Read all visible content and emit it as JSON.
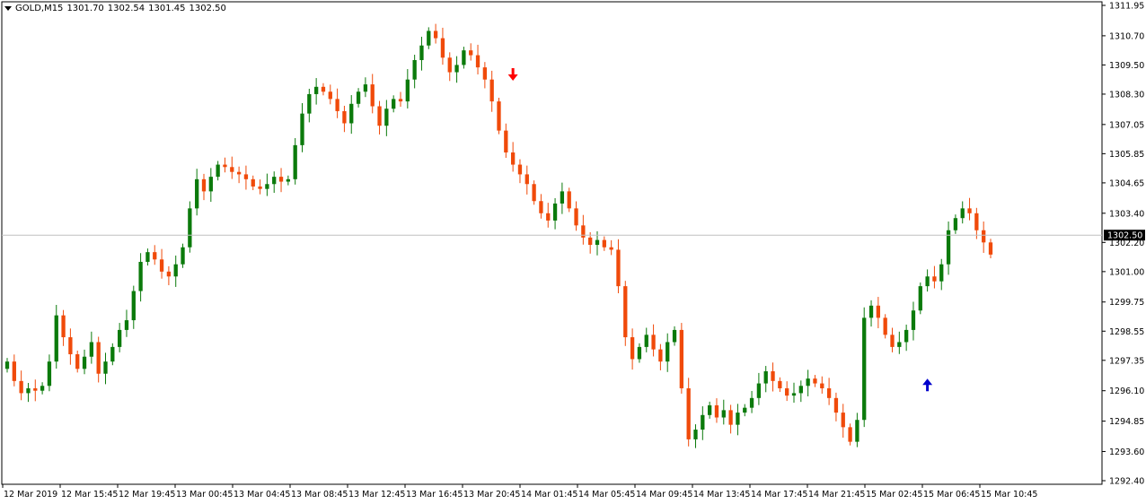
{
  "header": {
    "symbol_timeframe": "GOLD,M15",
    "open": "1301.70",
    "high": "1302.54",
    "low": "1301.45",
    "close": "1302.50"
  },
  "current_price_label": "1302.50",
  "colors": {
    "bull": "#0b7a0b",
    "bear": "#f04a0a",
    "sell_arrow": "#ff0000",
    "buy_arrow": "#0000cc",
    "grid_line": "#c0c0c0",
    "price_tag_bg": "#000000",
    "price_tag_text": "#ffffff"
  },
  "chart_data": {
    "type": "candlestick",
    "instrument": "GOLD",
    "timeframe": "M15",
    "ylim": [
      1292.4,
      1311.95
    ],
    "y_ticks": [
      "1311.95",
      "1310.70",
      "1309.50",
      "1308.30",
      "1307.05",
      "1305.85",
      "1304.65",
      "1303.40",
      "1302.20",
      "1301.00",
      "1299.75",
      "1298.55",
      "1297.35",
      "1296.10",
      "1294.85",
      "1293.60",
      "1292.40"
    ],
    "x_ticks": [
      "12 Mar 2019",
      "12 Mar 15:45",
      "12 Mar 19:45",
      "13 Mar 00:45",
      "13 Mar 04:45",
      "13 Mar 08:45",
      "13 Mar 12:45",
      "13 Mar 16:45",
      "13 Mar 20:45",
      "14 Mar 01:45",
      "14 Mar 05:45",
      "14 Mar 09:45",
      "14 Mar 13:45",
      "14 Mar 17:45",
      "14 Mar 21:45",
      "15 Mar 02:45",
      "15 Mar 06:45",
      "15 Mar 10:45"
    ],
    "current_price": 1302.5,
    "close_path": [
      1297.3,
      1296.5,
      1296.0,
      1296.2,
      1296.1,
      1296.3,
      1297.3,
      1299.2,
      1298.3,
      1297.6,
      1297.0,
      1297.5,
      1298.1,
      1296.8,
      1297.3,
      1297.9,
      1298.6,
      1299.0,
      1300.2,
      1301.4,
      1301.8,
      1301.5,
      1301.0,
      1300.8,
      1301.3,
      1302.0,
      1303.6,
      1304.8,
      1304.3,
      1304.9,
      1305.4,
      1305.3,
      1305.1,
      1305.0,
      1304.8,
      1304.5,
      1304.4,
      1304.6,
      1304.9,
      1304.7,
      1304.8,
      1306.2,
      1307.5,
      1308.3,
      1308.6,
      1308.4,
      1308.1,
      1307.6,
      1307.1,
      1307.9,
      1308.4,
      1308.7,
      1307.8,
      1307.0,
      1307.7,
      1308.1,
      1308.0,
      1308.9,
      1309.7,
      1310.3,
      1310.9,
      1310.6,
      1309.8,
      1309.2,
      1309.5,
      1310.1,
      1309.9,
      1309.4,
      1308.9,
      1308.0,
      1306.8,
      1305.9,
      1305.4,
      1305.0,
      1304.6,
      1303.9,
      1303.4,
      1303.1,
      1303.8,
      1304.3,
      1303.6,
      1302.9,
      1302.4,
      1302.1,
      1302.3,
      1302.0,
      1301.9,
      1300.4,
      1298.3,
      1297.4,
      1297.9,
      1298.4,
      1297.8,
      1297.3,
      1298.1,
      1298.6,
      1296.2,
      1294.1,
      1294.5,
      1295.1,
      1295.5,
      1295.0,
      1295.3,
      1294.7,
      1295.2,
      1295.4,
      1295.8,
      1296.4,
      1296.9,
      1296.5,
      1296.2,
      1295.9,
      1296.0,
      1296.3,
      1296.6,
      1296.4,
      1296.2,
      1295.8,
      1295.2,
      1294.6,
      1294.0,
      1294.9,
      1299.1,
      1299.6,
      1299.1,
      1298.4,
      1297.9,
      1298.1,
      1298.6,
      1299.4,
      1300.4,
      1300.8,
      1300.6,
      1301.3,
      1302.7,
      1303.2,
      1303.6,
      1303.4,
      1302.7,
      1302.2,
      1301.7
    ],
    "signals": [
      {
        "type": "sell",
        "bar_index": 72,
        "price": 1309.0
      },
      {
        "type": "buy",
        "bar_index": 131,
        "price": 1296.3
      }
    ]
  }
}
